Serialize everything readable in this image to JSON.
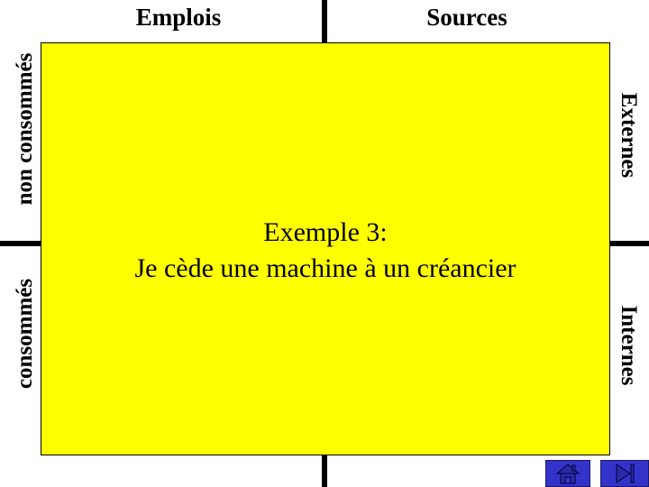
{
  "headers": {
    "left": "Emplois",
    "right": "Sources"
  },
  "side_labels": {
    "left_top": "non consommés",
    "left_bottom": "consommés",
    "right_top": "Externes",
    "right_bottom": "Internes"
  },
  "main": {
    "line1": "Exemple 3:",
    "line2": "Je cède une machine à un créancier"
  },
  "colors": {
    "box_fill": "#ffff00",
    "nav_button": "#3333cc"
  },
  "nav": {
    "home_icon": "home-icon",
    "end_icon": "skip-to-end-icon"
  }
}
